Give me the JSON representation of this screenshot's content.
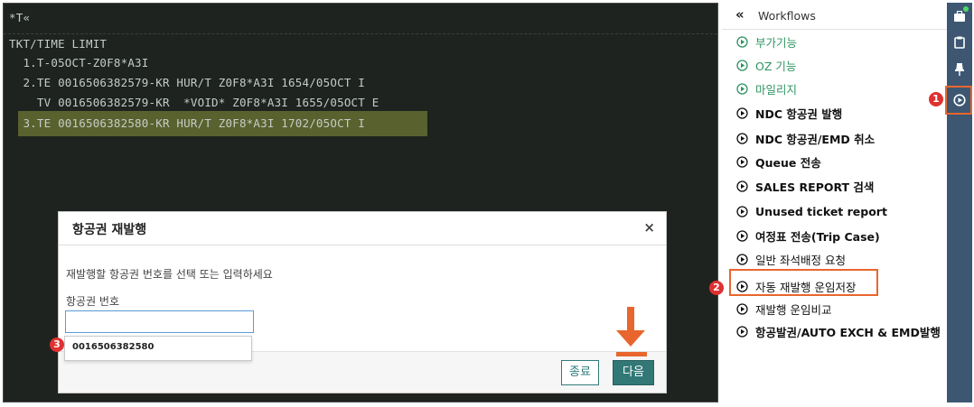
{
  "terminal": {
    "lines": [
      "*T«",
      "TKT/TIME LIMIT",
      "  1.T-05OCT-Z0F8*A3I",
      "  2.TE 0016506382579-KR HUR/T Z0F8*A3I 1654/05OCT I",
      "    TV 0016506382579-KR  *VOID* Z0F8*A3I 1655/05OCT E",
      "  3.TE 0016506382580-KR HUR/T Z0F8*A3I 1702/05OCT I"
    ]
  },
  "dialog": {
    "title": "항공권 재발행",
    "close": "×",
    "description": "재발행할 항공권 번호를 선택 또는 입력하세요",
    "field_label": "항공권 번호",
    "input_value": "",
    "suggestion": "0016506382580",
    "cancel_label": "종료",
    "next_label": "다음"
  },
  "workflows": {
    "collapse": "«",
    "title": "Workflows",
    "items": [
      {
        "label": "부가기능",
        "style": "green"
      },
      {
        "label": "OZ 기능",
        "style": "green"
      },
      {
        "label": "마일리지",
        "style": "green"
      },
      {
        "label": "NDC 항공권 발행",
        "style": "normal"
      },
      {
        "label": "NDC 항공권/EMD 취소",
        "style": "normal"
      },
      {
        "label": "Queue 전송",
        "style": "normal"
      },
      {
        "label": "SALES REPORT 검색",
        "style": "normal"
      },
      {
        "label": "Unused ticket report",
        "style": "normal"
      },
      {
        "label": "여정표 전송(Trip Case)",
        "style": "normal"
      },
      {
        "label": "일반 좌석배정 요청",
        "style": "normal"
      },
      {
        "label": "자동 재발행 운임저장",
        "style": "highlight"
      },
      {
        "label": "재발행 운임비교",
        "style": "normal"
      },
      {
        "label": "항공발권/AUTO EXCH & EMD발행",
        "style": "normal"
      }
    ]
  },
  "badges": {
    "one": "1",
    "two": "2",
    "three": "3"
  },
  "colors": {
    "terminal_bg": "#1e2320",
    "terminal_text": "#c5ccc6",
    "highlight_row": "#59612f",
    "accent_teal": "#317876",
    "callout_orange": "#e8662e",
    "badge_red": "#e03131",
    "rail_bg": "#3d5773",
    "workflow_green": "#2e9462"
  }
}
